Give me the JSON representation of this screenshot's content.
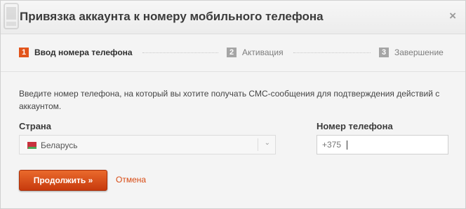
{
  "dialog": {
    "title": "Привязка аккаунта к номеру мобильного телефона",
    "close_glyph": "×"
  },
  "steps": [
    {
      "number": "1",
      "label": "Ввод номера телефона",
      "state": "active"
    },
    {
      "number": "2",
      "label": "Активация",
      "state": "inactive"
    },
    {
      "number": "3",
      "label": "Завершение",
      "state": "inactive"
    }
  ],
  "form": {
    "description": "Введите номер телефона, на который вы хотите получать СМС-сообщения для подтверждения действий с аккаунтом.",
    "country_label": "Страна",
    "country_value": "Беларусь",
    "phone_label": "Номер телефона",
    "phone_value": "+375"
  },
  "actions": {
    "continue_label": "Продолжить »",
    "cancel_label": "Отмена"
  },
  "icons": {
    "phone": "phone-icon",
    "close": "close-icon",
    "flag": "belarus-flag-icon",
    "dropdown": "chevron-down-icon"
  },
  "colors": {
    "accent": "#e2541b",
    "link": "#d84a12",
    "step_inactive": "#a5a5a5"
  }
}
